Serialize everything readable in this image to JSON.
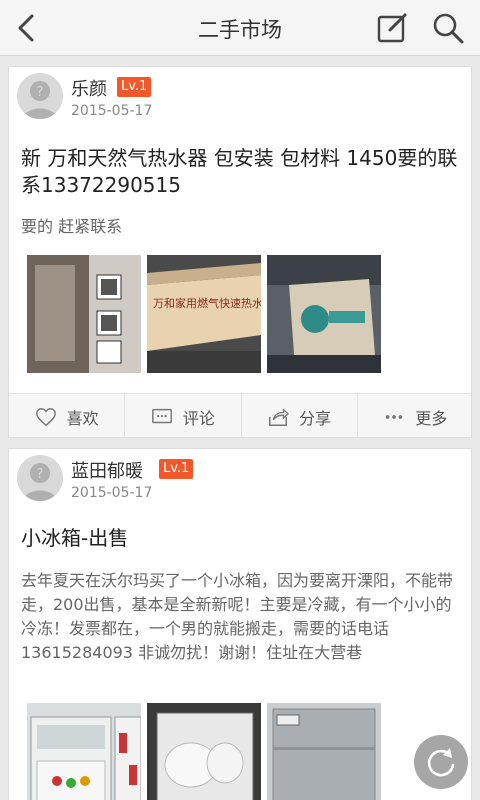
{
  "header": {
    "title": "二手市场",
    "back_icon": "chevron-left-icon",
    "edit_icon": "edit-icon",
    "search_icon": "search-icon"
  },
  "posts": [
    {
      "username": "乐颜",
      "level": "Lv.1",
      "date": "2015-05-17",
      "title": "新 万和天然气热水器 包安装 包材料 1450要的联系13372290515",
      "body": "要的 赶紧联系",
      "images": [
        "water-heater-box-photo",
        "water-heater-box-label-photo",
        "boxed-appliance-photo"
      ],
      "actions": {
        "like": "喜欢",
        "comment": "评论",
        "share": "分享",
        "more": "更多"
      }
    },
    {
      "username": "蓝田郁暖",
      "level": "Lv.1",
      "date": "2015-05-17",
      "title": "小冰箱-出售",
      "body": "去年夏天在沃尔玛买了一个小冰箱，因为要离开溧阳，不能带走，200出售，基本是全新新呢！主要是冷藏，有一个小小的冷冻！发票都在，一个男的就能搬走，需要的话电话13615284093 非诚勿扰！谢谢！住址在大营巷",
      "images": [
        "fridge-open-photo",
        "fridge-freezer-photo",
        "fridge-closed-photo"
      ]
    }
  ],
  "colors": {
    "level_badge": "#f2582a",
    "header_bg": "#f5f5f5",
    "page_bg": "#e9e9e9"
  }
}
